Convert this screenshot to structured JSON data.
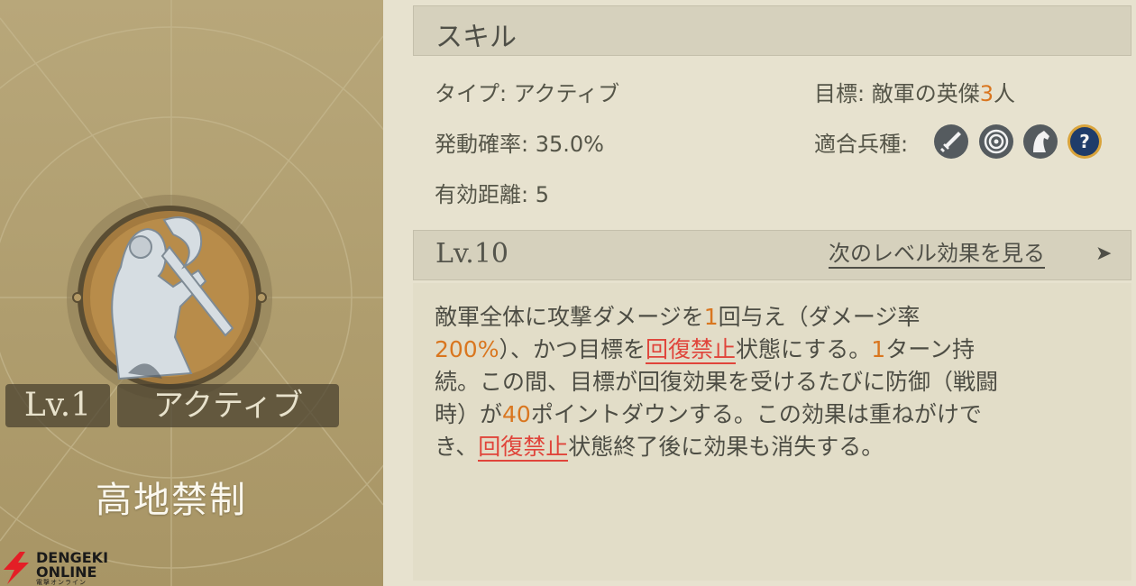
{
  "skill_card": {
    "level": "Lv.1",
    "type": "アクティブ",
    "name": "高地禁制"
  },
  "watermark": {
    "line1": "DENGEKI",
    "line2": "ONLINE",
    "line3": "電撃オンライン"
  },
  "header": {
    "title": "スキル"
  },
  "info": {
    "type_label": "タイプ:",
    "type_value": "アクティブ",
    "rate_label": "発動確率:",
    "rate_value": "35.0%",
    "range_label": "有効距離:",
    "range_value": "5",
    "target_label": "目標:",
    "target_prefix": "敵軍の英傑",
    "target_count": "3",
    "target_suffix": "人",
    "troops_label": "適合兵種:",
    "troop_icons": [
      "sword-icon",
      "target-icon",
      "horse-icon",
      "question-icon"
    ]
  },
  "level_bar": {
    "level": "Lv.10",
    "next_link": "次のレベル効果を見る",
    "arrow": "➤"
  },
  "description": {
    "p1": "敵軍全体に攻撃ダメージを",
    "n1": "1",
    "p2": "回与え（ダメージ率\n",
    "n2": "200%",
    "p3": "）、かつ目標を",
    "s1": "回復禁止",
    "p4": "状態にする。",
    "n3": "1",
    "p5": "ターン持\n続。この間、目標が回復効果を受けるたびに防御（戦闘\n時）が",
    "n4": "40",
    "p6": "ポイントダウンする。この効果は重ねがけで\nき、",
    "s2": "回復禁止",
    "p7": "状態終了後に効果も消失する。"
  },
  "colors": {
    "accent": "#d9761f",
    "status": "#e0443a",
    "panel": "#b8a77a"
  }
}
